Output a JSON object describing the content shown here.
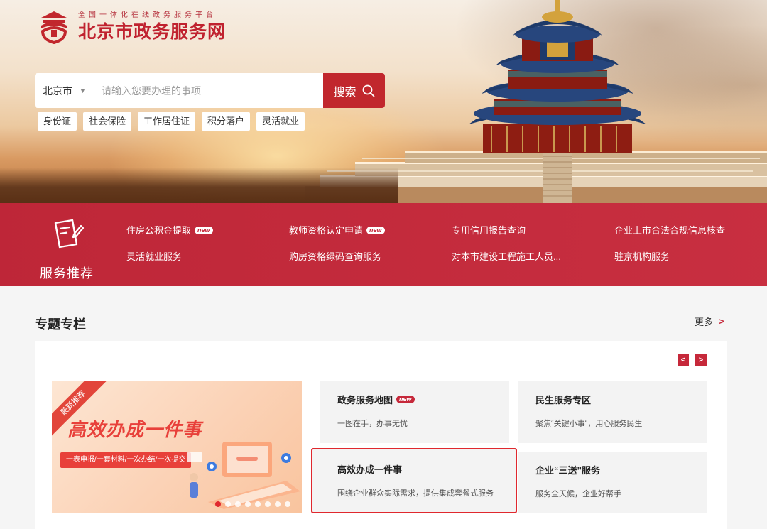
{
  "header": {
    "logo_sub": "全国一体化在线政务服务平台",
    "logo_title": "北京市政务服务网"
  },
  "search": {
    "city": "北京市",
    "placeholder": "请输入您要办理的事项",
    "button_label": "搜索",
    "tags": [
      "身份证",
      "社会保险",
      "工作居住证",
      "积分落户",
      "灵活就业"
    ]
  },
  "recommend": {
    "title": "服务推荐",
    "links": [
      {
        "label": "住房公积金提取",
        "badge": "new"
      },
      {
        "label": "教师资格认定申请",
        "badge": "new"
      },
      {
        "label": "专用信用报告查询",
        "badge": ""
      },
      {
        "label": "企业上市合法合规信息核查",
        "badge": ""
      },
      {
        "label": "灵活就业服务",
        "badge": ""
      },
      {
        "label": "购房资格绿码查询服务",
        "badge": ""
      },
      {
        "label": "对本市建设工程施工人员...",
        "badge": ""
      },
      {
        "label": "驻京机构服务",
        "badge": ""
      }
    ]
  },
  "topics": {
    "title": "专题专栏",
    "more_label": "更多",
    "more_arrow": ">",
    "prev": "<",
    "next": ">",
    "banner": {
      "ribbon": "最新推荐",
      "title": "高效办成一件事",
      "slogan": "一表申报/一套材料/一次办结/一次提交",
      "dots_total": 8,
      "dots_active": 0
    },
    "cards": [
      {
        "title": "政务服务地图",
        "badge": "new",
        "desc": "一图在手，办事无忧"
      },
      {
        "title": "民生服务专区",
        "badge": "",
        "desc": "聚焦“关键小事”，用心服务民生"
      },
      {
        "title": "高效办成一件事",
        "badge": "",
        "desc": "围绕企业群众实际需求，提供集成套餐式服务"
      },
      {
        "title": "企业“三送”服务",
        "badge": "",
        "desc": "服务全天候，企业好帮手"
      }
    ]
  },
  "colors": {
    "brand_red": "#c1272d",
    "band_red": "#c6283a",
    "highlight_red": "#e0282e"
  }
}
